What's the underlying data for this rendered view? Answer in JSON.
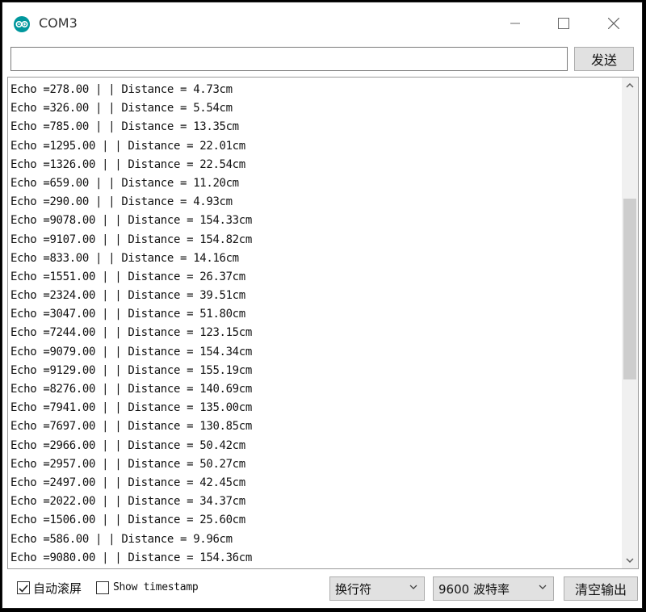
{
  "window": {
    "title": "COM3",
    "controls": {
      "minimize": "minimize-icon",
      "maximize": "maximize-icon",
      "close": "close-icon"
    }
  },
  "send_bar": {
    "input_value": "",
    "send_label": "发送"
  },
  "output_lines": [
    "Echo =278.00 | | Distance = 4.73cm",
    "Echo =326.00 | | Distance = 5.54cm",
    "Echo =785.00 | | Distance = 13.35cm",
    "Echo =1295.00 | | Distance = 22.01cm",
    "Echo =1326.00 | | Distance = 22.54cm",
    "Echo =659.00 | | Distance = 11.20cm",
    "Echo =290.00 | | Distance = 4.93cm",
    "Echo =9078.00 | | Distance = 154.33cm",
    "Echo =9107.00 | | Distance = 154.82cm",
    "Echo =833.00 | | Distance = 14.16cm",
    "Echo =1551.00 | | Distance = 26.37cm",
    "Echo =2324.00 | | Distance = 39.51cm",
    "Echo =3047.00 | | Distance = 51.80cm",
    "Echo =7244.00 | | Distance = 123.15cm",
    "Echo =9079.00 | | Distance = 154.34cm",
    "Echo =9129.00 | | Distance = 155.19cm",
    "Echo =8276.00 | | Distance = 140.69cm",
    "Echo =7941.00 | | Distance = 135.00cm",
    "Echo =7697.00 | | Distance = 130.85cm",
    "Echo =2966.00 | | Distance = 50.42cm",
    "Echo =2957.00 | | Distance = 50.27cm",
    "Echo =2497.00 | | Distance = 42.45cm",
    "Echo =2022.00 | | Distance = 34.37cm",
    "Echo =1506.00 | | Distance = 25.60cm",
    "Echo =586.00 | | Distance = 9.96cm",
    "Echo =9080.00 | | Distance = 154.36cm"
  ],
  "bottom_bar": {
    "autoscroll_label": "自动滚屏",
    "autoscroll_checked": true,
    "timestamp_label": "Show timestamp",
    "timestamp_checked": false,
    "line_ending": "换行符",
    "baud_rate": "9600 波特率",
    "clear_label": "清空输出"
  },
  "colors": {
    "app_icon": "#00979d",
    "button_bg": "#e1e1e1",
    "scrollbar_thumb": "#cdcdcd"
  }
}
